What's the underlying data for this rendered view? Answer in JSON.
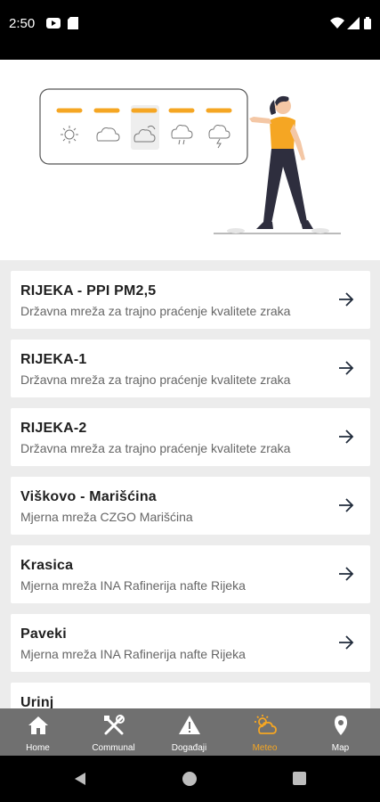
{
  "status_bar": {
    "time": "2:50"
  },
  "stations": [
    {
      "name": "RIJEKA - PPI PM2,5",
      "network": "Državna mreža za trajno praćenje kvalitete zraka"
    },
    {
      "name": "RIJEKA-1",
      "network": "Državna mreža za trajno praćenje kvalitete zraka"
    },
    {
      "name": "RIJEKA-2",
      "network": "Državna mreža za trajno praćenje kvalitete zraka"
    },
    {
      "name": "Viškovo - Marišćina",
      "network": "Mjerna mreža CZGO Marišćina"
    },
    {
      "name": "Krasica",
      "network": "Mjerna mreža INA Rafinerija nafte Rijeka"
    },
    {
      "name": "Paveki",
      "network": "Mjerna mreža INA Rafinerija nafte Rijeka"
    },
    {
      "name": "Urinj",
      "network": ""
    }
  ],
  "bottom_nav": {
    "items": [
      {
        "label": "Home",
        "icon": "home-icon"
      },
      {
        "label": "Communal",
        "icon": "tools-icon"
      },
      {
        "label": "Događaji",
        "icon": "warning-icon"
      },
      {
        "label": "Meteo",
        "icon": "weather-icon",
        "active": true
      },
      {
        "label": "Map",
        "icon": "map-pin-icon"
      }
    ]
  },
  "colors": {
    "accent": "#f5a623",
    "nav_bg": "#707070",
    "arrow": "#1f2a3a"
  }
}
